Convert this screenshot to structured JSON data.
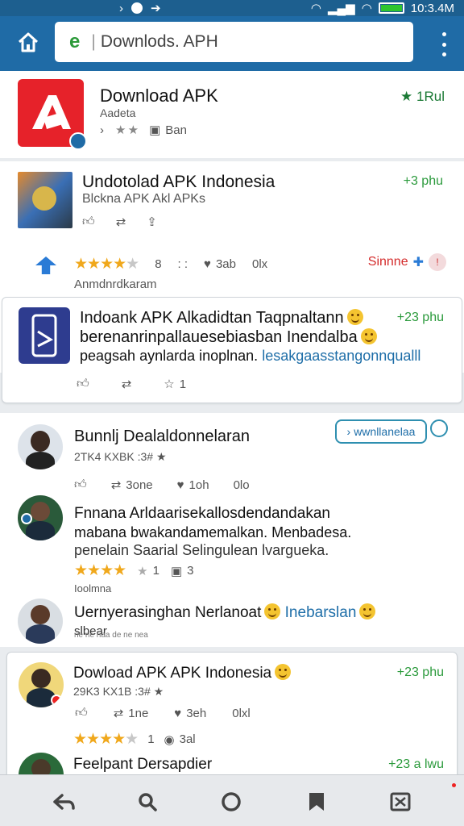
{
  "status_bar": {
    "time": "10:3.4M",
    "battery_level": 0.95
  },
  "browser": {
    "url_text": "Downlods. APH"
  },
  "hero": {
    "title": "Download APK",
    "subtitle": "Aadeta",
    "meta": "Ban",
    "rating_label": "1Rul"
  },
  "post1": {
    "title": "Undotolad APK Indonesia",
    "subtitle": "Blckna APK Akl APKs",
    "time": "+3 phu",
    "stars_label": "8",
    "comments": "3ab",
    "shares": "0lx",
    "footer": "Anmdnrdkaram",
    "badge": "Sinnne"
  },
  "post2": {
    "line1": "Indoank APK Alkadidtan Taqpnaltann",
    "line2": "berenanrinpallauesebiasban Inendalba",
    "line3_prefix": "peagsah aynlarda inoplnan.",
    "line3_link": "lesakgaasstangonnqualll",
    "time": "+23 phu",
    "likes": "1"
  },
  "feed": {
    "follow_label": "wwnllanelaa",
    "item1": {
      "name": "Bunnlj Dealaldonnelaran",
      "meta": "2TK4 KXBK :3#",
      "reposts": "3one",
      "likes": "1oh",
      "views": "0lo"
    },
    "item2": {
      "line1": "Fnnana Arldaarisekallosdendandakan",
      "line2": "mabana bwakandamemalkan. Menbadesa.",
      "line3": "penelain Saarial Selingulean lvargueka.",
      "stars_count": "1",
      "saves": "3",
      "footer": "Ioolmna"
    },
    "item3": {
      "line1": "Uernyerasinghan Nerlanoat",
      "link": "Inebarslan",
      "line2": "slbear",
      "line3": "ne ne naa de ne nea"
    }
  },
  "post3": {
    "title": "Dowload APK APK Indonesia",
    "meta": "29K3 KX1B :3#",
    "time": "+23 phu",
    "reposts": "1ne",
    "likes": "3eh",
    "views": "0lxl",
    "stars_count": "1",
    "badge": "3al",
    "next_title": "Feelpant Dersapdier",
    "next_time": "+23 a lwu"
  }
}
